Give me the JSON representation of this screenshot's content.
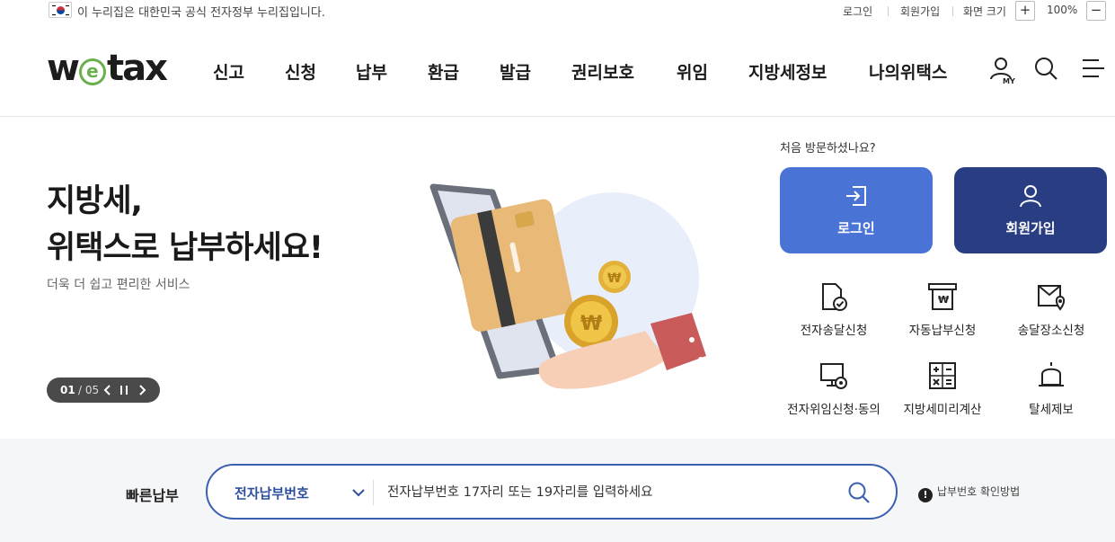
{
  "topbar": {
    "gov_notice": "이 누리집은 대한민국 공식 전자정부 누리집입니다.",
    "login": "로그인",
    "signup": "회원가입",
    "zoom_label": "화면 크기",
    "zoom_plus": "+",
    "zoom_value": "100%",
    "zoom_minus": "−"
  },
  "header": {
    "logo_part1": "w",
    "logo_e": "e",
    "logo_part2": "tax",
    "nav": [
      "신고",
      "신청",
      "납부",
      "환급",
      "발급",
      "권리보호",
      "위임",
      "지방세정보",
      "나의위택스"
    ],
    "my_label": "MY",
    "icons": [
      "my-page-icon",
      "search-icon",
      "menu-icon"
    ]
  },
  "hero": {
    "title_line1": "지방세,",
    "title_line2": "위택스로 납부하세요!",
    "subtitle": "더욱 더 쉽고 편리한 서비스",
    "pager_current": "01",
    "pager_total": "/ 05"
  },
  "member": {
    "first_visit": "처음 방문하셨나요?",
    "login_button": "로그인",
    "signup_button": "회원가입",
    "login_color": "#4a73d6",
    "signup_color": "#293d82"
  },
  "quick_links": [
    {
      "label": "전자송달신청",
      "icon": "document-check-icon"
    },
    {
      "label": "자동납부신청",
      "icon": "auto-pay-icon"
    },
    {
      "label": "송달장소신청",
      "icon": "mail-location-icon"
    },
    {
      "label": "전자위임신청·동의",
      "icon": "monitor-delegation-icon"
    },
    {
      "label": "지방세미리계산",
      "icon": "calculator-icon"
    },
    {
      "label": "탈세제보",
      "icon": "alarm-bell-icon"
    }
  ],
  "quick_pay": {
    "label": "빠른납부",
    "select_value": "전자납부번호",
    "placeholder": "전자납부번호 17자리 또는 19자리를 입력하세요",
    "help": "납부번호 확인방법",
    "accent": "#3b5fb0"
  }
}
